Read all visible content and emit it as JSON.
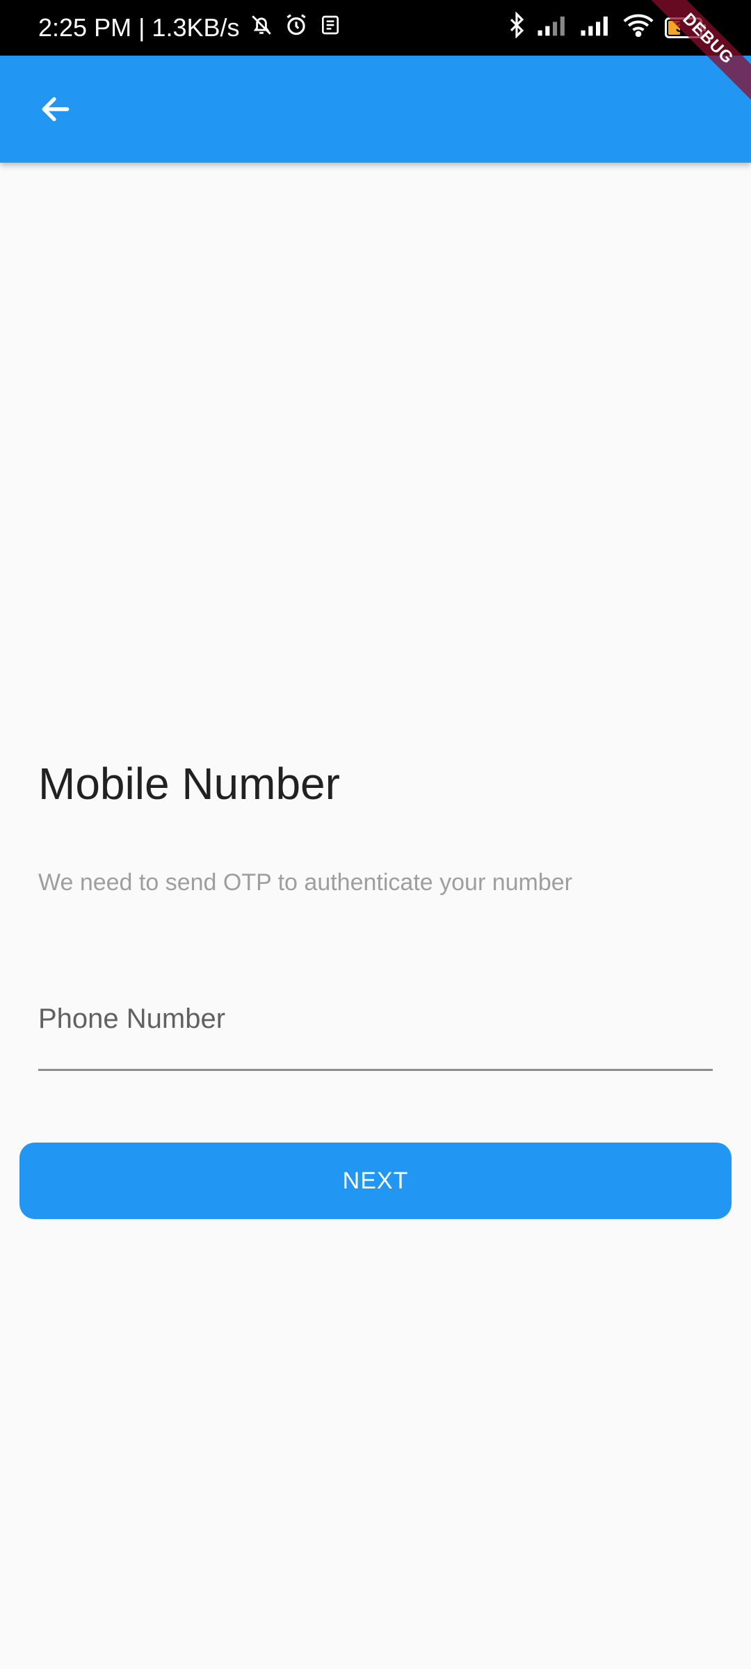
{
  "status_bar": {
    "time_and_speed": "2:25 PM | 1.3KB/s",
    "battery_level": "39",
    "battery_fraction": 0.39,
    "icons": [
      "bell-muted-icon",
      "alarm-clock-icon",
      "news-icon",
      "bluetooth-icon",
      "signal-1-icon",
      "signal-2-icon",
      "wifi-icon",
      "battery-icon"
    ]
  },
  "debug_banner": "DEBUG",
  "app_bar": {
    "back_icon": "arrow-left-icon",
    "color": "#2196f3"
  },
  "main": {
    "title": "Mobile Number",
    "subtitle": "We need to send OTP to authenticate your number",
    "phone_field": {
      "placeholder": "Phone Number",
      "value": ""
    },
    "next_button_label": "NEXT"
  },
  "colors": {
    "accent": "#2196f3",
    "background": "#fafafa",
    "debug_ribbon": "#880e2c"
  }
}
